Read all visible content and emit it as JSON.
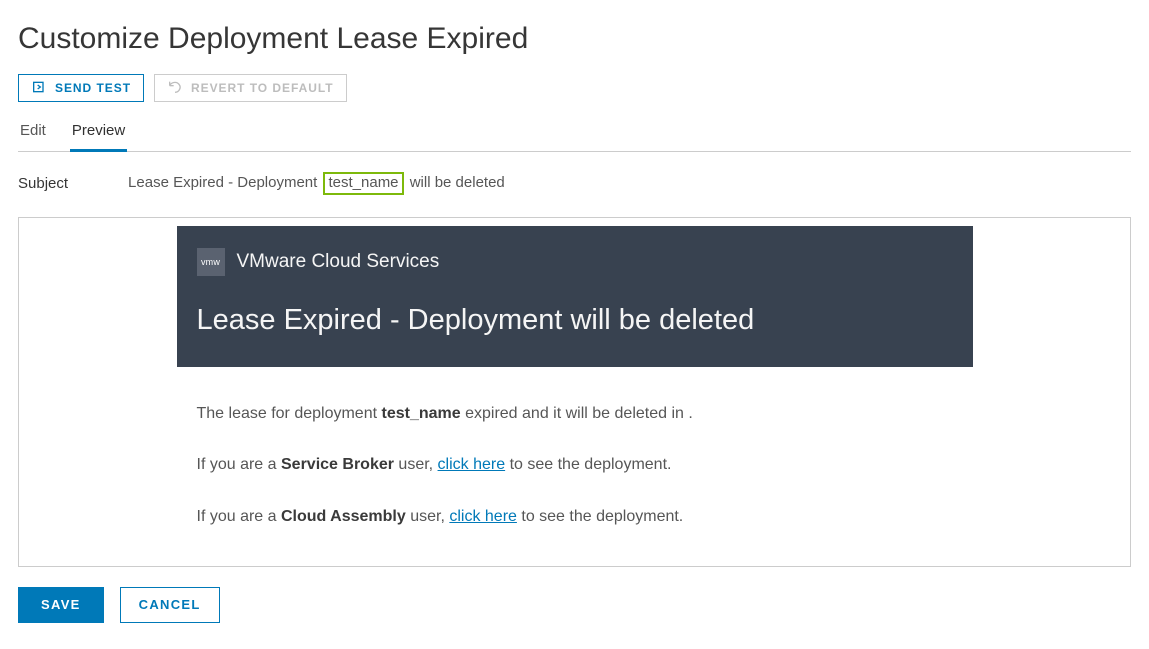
{
  "page": {
    "title": "Customize Deployment Lease Expired"
  },
  "toolbar": {
    "send_test": "SEND TEST",
    "revert": "REVERT TO DEFAULT"
  },
  "tabs": {
    "edit": "Edit",
    "preview": "Preview"
  },
  "subject": {
    "label": "Subject",
    "prefix": "Lease Expired - Deployment ",
    "variable": "test_name",
    "suffix": " will be deleted"
  },
  "email": {
    "brand_icon_text": "vmw",
    "brand_name": "VMware Cloud Services",
    "title": "Lease Expired - Deployment will be deleted",
    "body": {
      "line1_pre": "The lease for deployment ",
      "line1_var": "test_name",
      "line1_post": " expired and it will be deleted in .",
      "line2_pre": "If you are a ",
      "line2_role": "Service Broker",
      "line2_mid": " user, ",
      "line2_link": "click here",
      "line2_post": " to see the deployment.",
      "line3_pre": "If you are a ",
      "line3_role": "Cloud Assembly",
      "line3_mid": " user, ",
      "line3_link": "click here",
      "line3_post": " to see the deployment."
    }
  },
  "footer": {
    "save": "SAVE",
    "cancel": "CANCEL"
  }
}
